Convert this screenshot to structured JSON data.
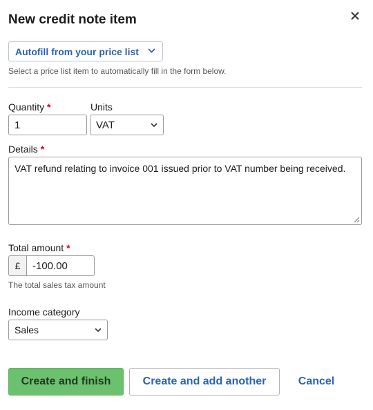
{
  "modal": {
    "title": "New credit note item"
  },
  "autofill": {
    "label": "Autofill from your price list",
    "hint": "Select a price list item to automatically fill in the form below."
  },
  "quantity": {
    "label": "Quantity",
    "required_mark": "*",
    "value": "1"
  },
  "units": {
    "label": "Units",
    "selected": "VAT"
  },
  "details": {
    "label": "Details",
    "required_mark": "*",
    "value": "VAT refund relating to invoice 001 issued prior to VAT number being received."
  },
  "total": {
    "label": "Total amount",
    "required_mark": "*",
    "currency_symbol": "£",
    "value": "-100.00",
    "hint": "The total sales tax amount"
  },
  "income_category": {
    "label": "Income category",
    "selected": "Sales"
  },
  "buttons": {
    "finish": "Create and finish",
    "another": "Create and add another",
    "cancel": "Cancel"
  },
  "colors": {
    "accent": "#2b62b8",
    "primary_button": "#6cc16f",
    "required": "#d0021b"
  },
  "icons": {
    "close": "close-icon",
    "dropdown": "chevron-down-icon",
    "resize": "resize-handle-icon"
  }
}
